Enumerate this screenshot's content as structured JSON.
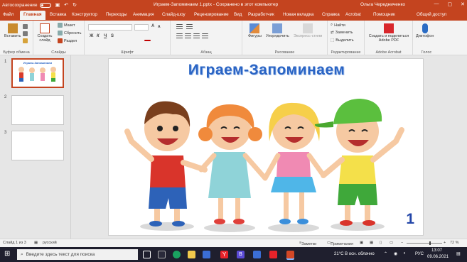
{
  "titlebar": {
    "autosave": "Автосохранение",
    "doc_title": "Играем-Запоминаем 1.pptx - Сохранено в этот компьютер",
    "user": "Ольга Чередниченко",
    "save_icon": "save-icon",
    "undo_icon": "undo-icon",
    "redo_icon": "redo-icon",
    "minimize": "—",
    "restore": "▢",
    "close": "✕"
  },
  "tabs": [
    "Файл",
    "Главная",
    "Вставка",
    "Конструктор",
    "Переходы",
    "Анимация",
    "Слайд-шоу",
    "Рецензирование",
    "Вид",
    "Разработчик",
    "Новая вкладка",
    "Справка",
    "Acrobat",
    "Помощник"
  ],
  "share": "Общий доступ",
  "ribbon": {
    "clipboard": {
      "paste": "Вставить",
      "label": "Буфер обмена"
    },
    "slides": {
      "new_slide": "Создать слайд",
      "layout": "Макет",
      "reset": "Сбросить",
      "section": "Раздел",
      "label": "Слайды"
    },
    "font": {
      "label": "Шрифт",
      "bold": "Ж",
      "italic": "К",
      "underline": "Ч",
      "strike": "S",
      "size_up": "A",
      "size_down": "A"
    },
    "paragraph": {
      "label": "Абзац"
    },
    "drawing": {
      "shapes": "Фигуры",
      "arrange": "Упорядочить",
      "quick_styles": "Экспресс-стили",
      "label": "Рисование"
    },
    "editing": {
      "find": "Найти",
      "replace": "Заменить",
      "select": "Выделить",
      "label": "Редактирование"
    },
    "acrobat": {
      "create": "Создать и поделиться Adobe PDF",
      "label": "Adobe Acrobat"
    },
    "voice": {
      "dictate": "Диктофон",
      "label": "Голос"
    }
  },
  "thumbnails": [
    {
      "num": "1",
      "title": "Играем-Запоминаем"
    },
    {
      "num": "2"
    },
    {
      "num": "3"
    }
  ],
  "slide": {
    "title": "Играем-Запоминаем",
    "number": "1"
  },
  "status": {
    "slide_info": "Слайд 1 из 3",
    "language": "русский",
    "notes": "Заметки",
    "comments": "Примечания",
    "zoom": "72 %"
  },
  "taskbar": {
    "search_placeholder": "Введите здесь текст для поиска",
    "weather": "21°C В осн. облачно",
    "lang": "РУС",
    "time": "13:07",
    "date": "09.06.2021"
  }
}
